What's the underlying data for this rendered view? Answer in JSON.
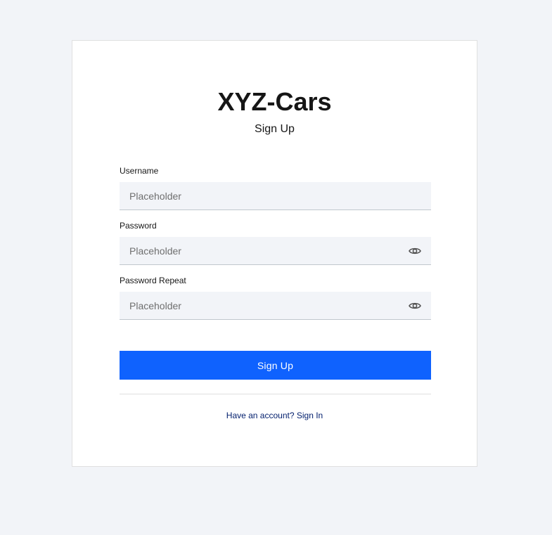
{
  "brand": {
    "title": "XYZ-Cars",
    "subtitle": "Sign Up"
  },
  "form": {
    "fields": [
      {
        "label": "Username",
        "placeholder": "Placeholder",
        "value": "",
        "type": "text"
      },
      {
        "label": "Password",
        "placeholder": "Placeholder",
        "value": "",
        "type": "password",
        "icon": "eye-icon"
      },
      {
        "label": "Password Repeat",
        "placeholder": "Placeholder",
        "value": "",
        "type": "password",
        "icon": "eye-icon"
      }
    ],
    "submit_label": "Sign Up"
  },
  "footer": {
    "link_text": "Have an account? Sign In"
  },
  "colors": {
    "background": "#f2f4f8",
    "card": "#ffffff",
    "primary": "#0f62fe",
    "input_bg": "#f2f4f8",
    "link": "#001d6c",
    "icon": "#525252"
  }
}
